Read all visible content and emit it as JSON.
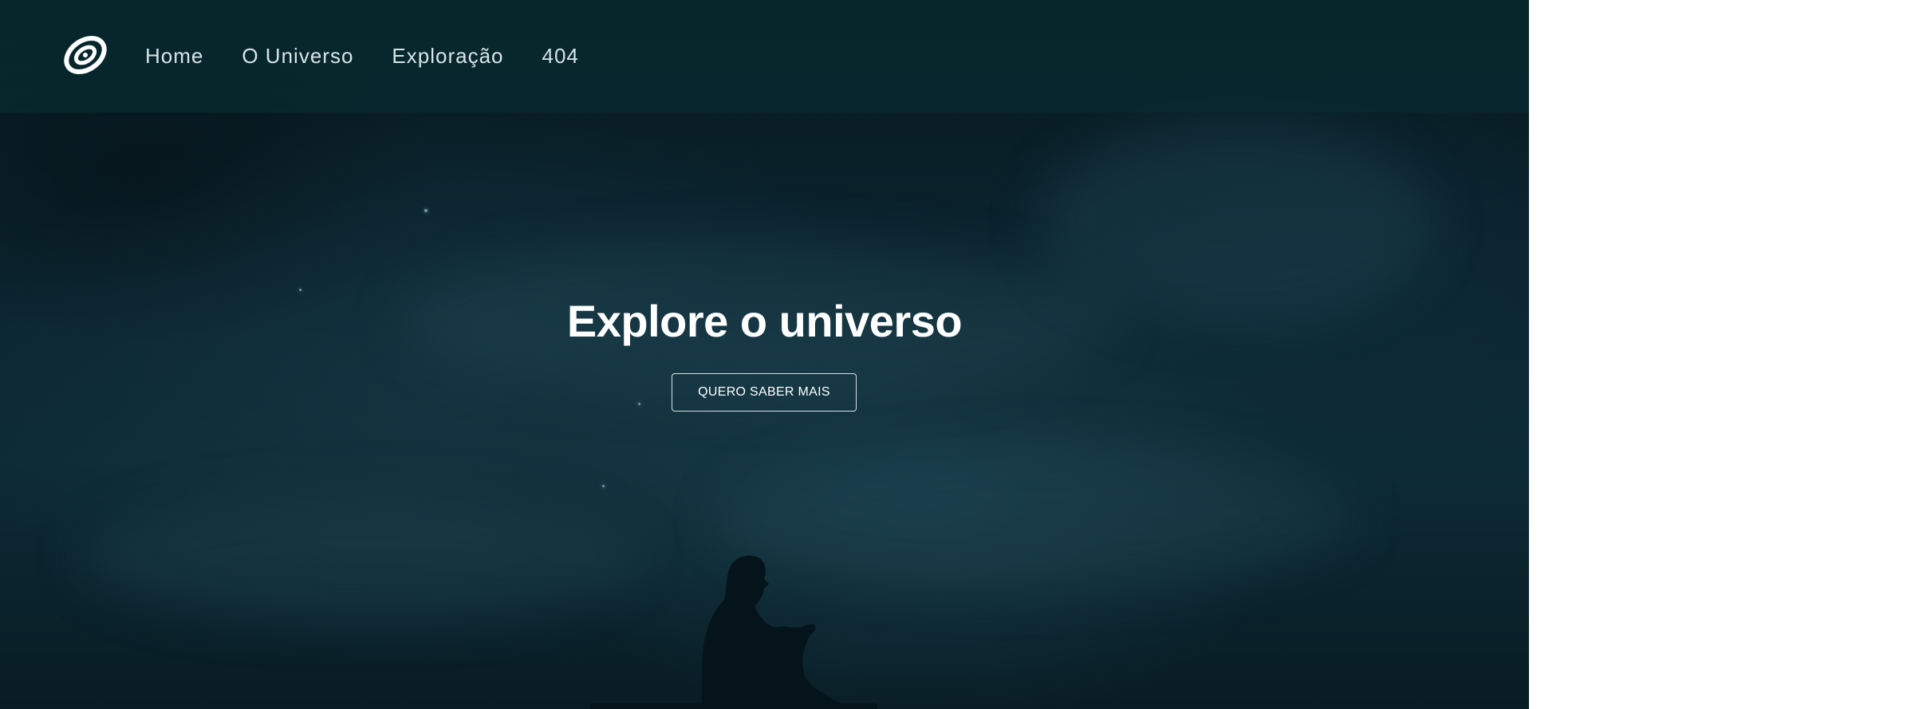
{
  "header": {
    "logo_icon": "spiral-galaxy-icon",
    "nav": [
      {
        "label": "Home"
      },
      {
        "label": "O Universo"
      },
      {
        "label": "Exploração"
      },
      {
        "label": "404"
      }
    ]
  },
  "hero": {
    "title": "Explore o universo",
    "cta_label": "QUERO SABER MAIS",
    "background_image": "night-sky-person-sitting-silhouette"
  },
  "colors": {
    "header_bg": "#062a30",
    "hero_bg": "#0b2530",
    "text": "#ffffff",
    "nav_text": "#d9e4e6",
    "page_bg": "#ffffff"
  }
}
